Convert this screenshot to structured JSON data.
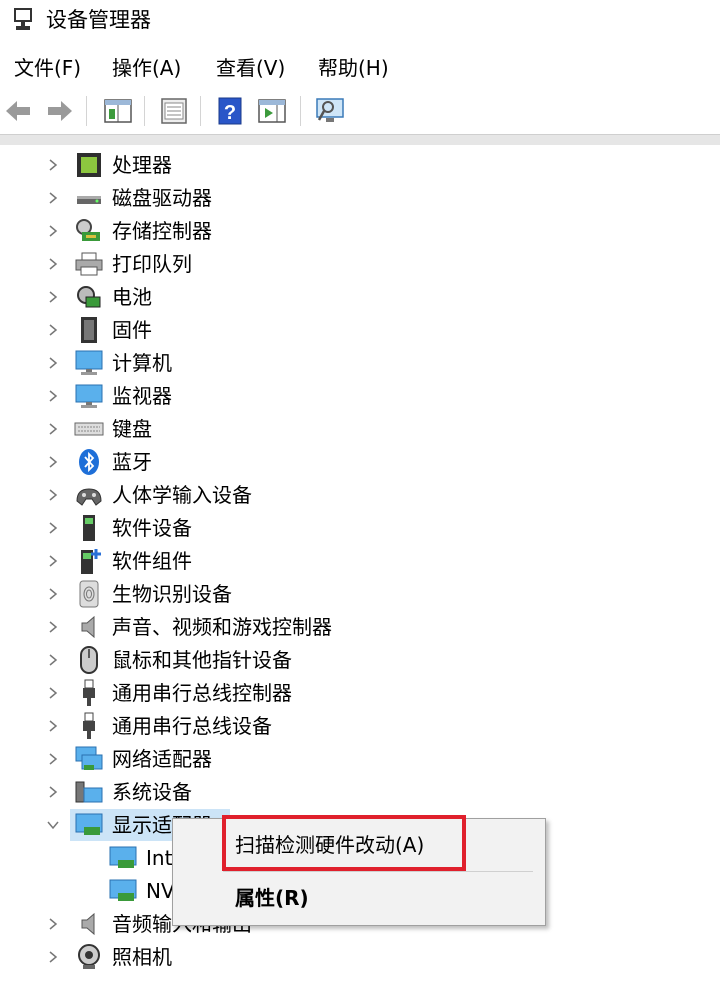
{
  "window": {
    "title": "设备管理器"
  },
  "menu": [
    "文件(F)",
    "操作(A)",
    "查看(V)",
    "帮助(H)"
  ],
  "toolbar": {
    "buttons": [
      "back-arrow-icon",
      "forward-arrow-icon",
      "show-hide-console-tree-icon",
      "properties-sheet-icon",
      "help-icon",
      "action-pane-icon",
      "scan-hardware-icon"
    ]
  },
  "tree": {
    "categories": [
      {
        "label": "处理器",
        "icon": "processor-icon"
      },
      {
        "label": "磁盘驱动器",
        "icon": "disk-drive-icon"
      },
      {
        "label": "存储控制器",
        "icon": "storage-controller-icon"
      },
      {
        "label": "打印队列",
        "icon": "printer-icon"
      },
      {
        "label": "电池",
        "icon": "battery-icon"
      },
      {
        "label": "固件",
        "icon": "firmware-icon"
      },
      {
        "label": "计算机",
        "icon": "computer-icon"
      },
      {
        "label": "监视器",
        "icon": "monitor-icon"
      },
      {
        "label": "键盘",
        "icon": "keyboard-icon"
      },
      {
        "label": "蓝牙",
        "icon": "bluetooth-icon"
      },
      {
        "label": "人体学输入设备",
        "icon": "hid-icon"
      },
      {
        "label": "软件设备",
        "icon": "software-device-icon"
      },
      {
        "label": "软件组件",
        "icon": "software-component-icon"
      },
      {
        "label": "生物识别设备",
        "icon": "fingerprint-icon"
      },
      {
        "label": "声音、视频和游戏控制器",
        "icon": "speaker-icon"
      },
      {
        "label": "鼠标和其他指针设备",
        "icon": "mouse-icon"
      },
      {
        "label": "通用串行总线控制器",
        "icon": "usb-icon"
      },
      {
        "label": "通用串行总线设备",
        "icon": "usb-icon"
      },
      {
        "label": "网络适配器",
        "icon": "network-adapter-icon"
      },
      {
        "label": "系统设备",
        "icon": "system-device-icon"
      },
      {
        "label": "显示适配器",
        "icon": "display-adapter-icon"
      }
    ],
    "display_children": [
      "Int",
      "NV"
    ],
    "after": [
      {
        "label": "音频输入和输出",
        "icon": "speaker-icon"
      },
      {
        "label": "照相机",
        "icon": "camera-icon"
      }
    ]
  },
  "context_menu": {
    "scan": "扫描检测硬件改动(A)",
    "properties": "属性(R)"
  },
  "colors": {
    "selection": "#cce4f7",
    "highlight_box": "#e0202c"
  }
}
